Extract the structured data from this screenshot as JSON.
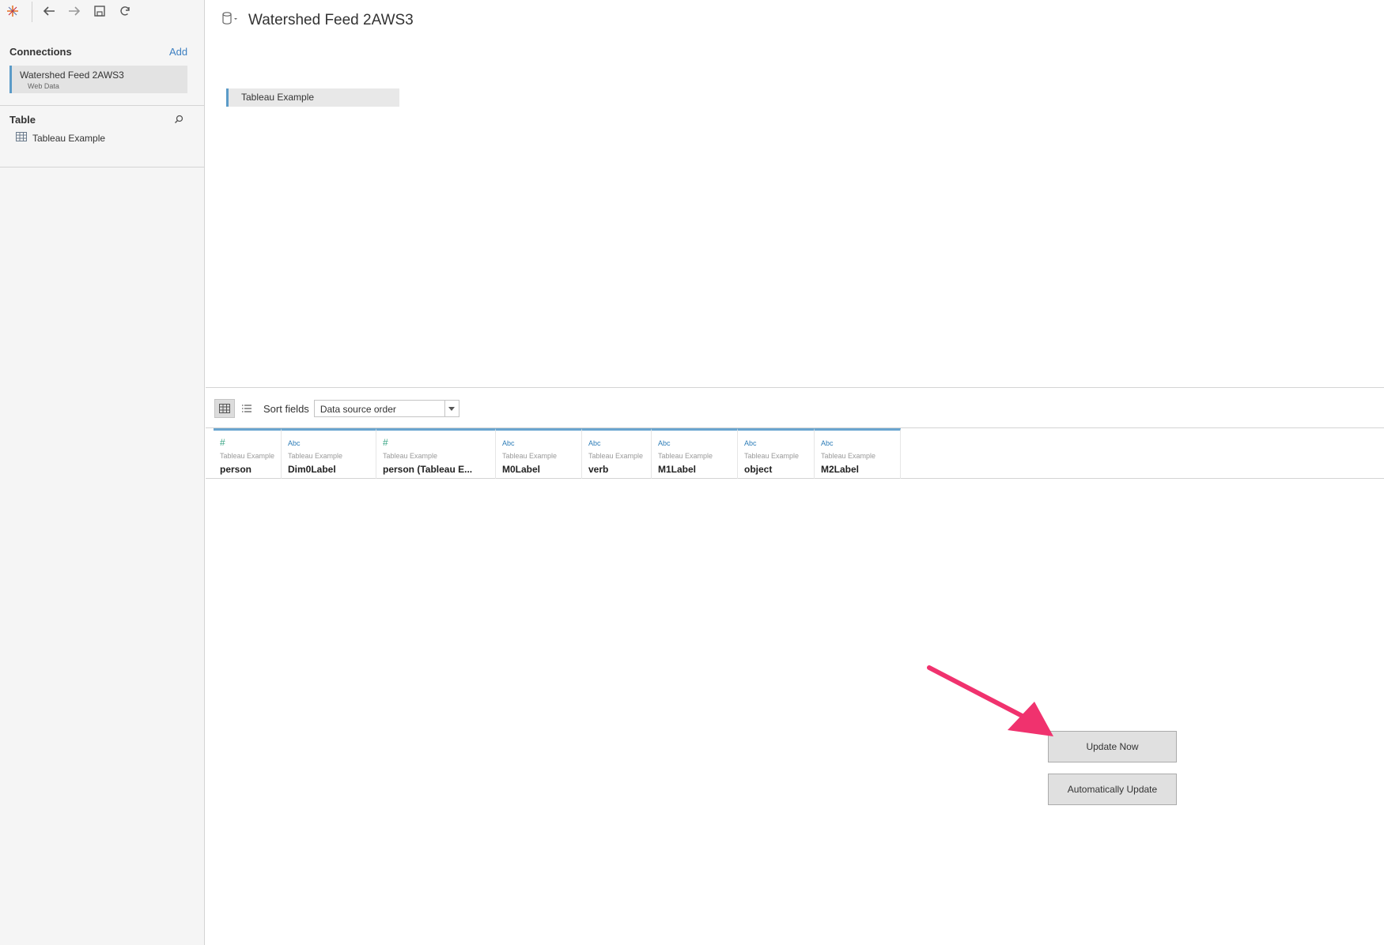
{
  "sidebar": {
    "connections_title": "Connections",
    "add_label": "Add",
    "connection": {
      "name": "Watershed Feed 2AWS3",
      "type": "Web Data"
    },
    "table_title": "Table",
    "table_item": "Tableau Example"
  },
  "main": {
    "datasource_title": "Watershed Feed 2AWS3",
    "canvas_table": "Tableau Example",
    "sort_label": "Sort fields",
    "sort_value": "Data source order",
    "fields": [
      {
        "type": "#",
        "source": "Tableau Example",
        "name": "person"
      },
      {
        "type": "Abc",
        "source": "Tableau Example",
        "name": "Dim0Label"
      },
      {
        "type": "#",
        "source": "Tableau Example",
        "name": "person (Tableau E..."
      },
      {
        "type": "Abc",
        "source": "Tableau Example",
        "name": "M0Label"
      },
      {
        "type": "Abc",
        "source": "Tableau Example",
        "name": "verb"
      },
      {
        "type": "Abc",
        "source": "Tableau Example",
        "name": "M1Label"
      },
      {
        "type": "Abc",
        "source": "Tableau Example",
        "name": "object"
      },
      {
        "type": "Abc",
        "source": "Tableau Example",
        "name": "M2Label"
      }
    ],
    "update_now": "Update Now",
    "auto_update": "Automatically Update"
  },
  "colors": {
    "accent": "#5b9bc8",
    "link": "#3d7fc1",
    "annotation_arrow": "#f0326e"
  }
}
